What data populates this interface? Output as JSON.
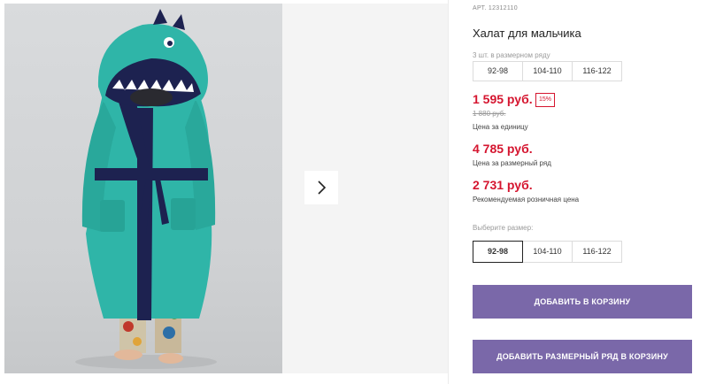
{
  "product": {
    "sku": "АРТ. 12312110",
    "title": "Халат для мальчика"
  },
  "pack": {
    "label": "3 шт. в размерном ряду",
    "sizes": [
      "92-98",
      "104-110",
      "116-122"
    ]
  },
  "prices": {
    "unit_price": "1 595 руб.",
    "discount": "15%",
    "old_price": "1 880 руб.",
    "unit_label": "Цена за единицу",
    "pack_price": "4 785 руб.",
    "pack_label": "Цена за размерный ряд",
    "rrp_price": "2 731 руб.",
    "rrp_label": "Рекомендуемая розничная цена"
  },
  "size_selector": {
    "label": "Выберите размер:",
    "options": [
      "92-98",
      "104-110",
      "116-122"
    ],
    "selected": "92-98"
  },
  "buttons": {
    "add_to_cart": "Добавить в корзину",
    "add_pack_to_cart": "Добавить размерный ряд в корзину"
  },
  "gallery": {
    "next_icon": "chevron-right-icon",
    "photo": "product-photo"
  },
  "colors": {
    "accent": "#7a68a9",
    "price": "#d5152f",
    "robe": "#2fb5a8",
    "trim": "#1d2250"
  }
}
